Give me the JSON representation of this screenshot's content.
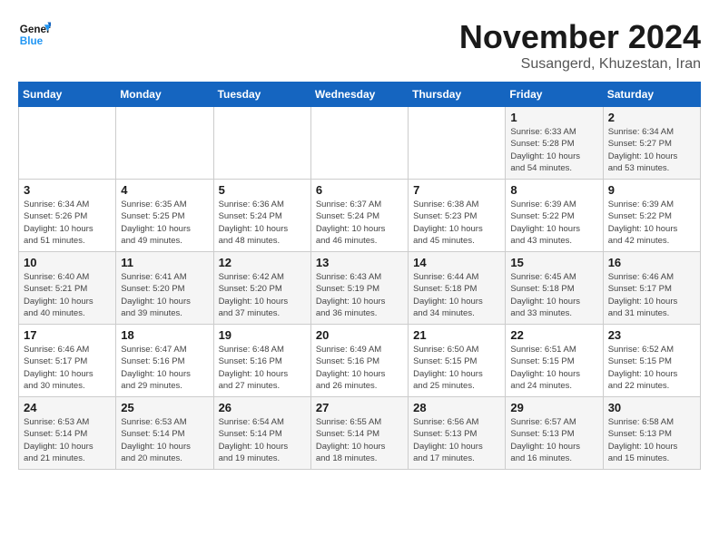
{
  "header": {
    "logo_line1": "General",
    "logo_line2": "Blue",
    "month": "November 2024",
    "location": "Susangerd, Khuzestan, Iran"
  },
  "days_of_week": [
    "Sunday",
    "Monday",
    "Tuesday",
    "Wednesday",
    "Thursday",
    "Friday",
    "Saturday"
  ],
  "weeks": [
    [
      {
        "day": "",
        "info": ""
      },
      {
        "day": "",
        "info": ""
      },
      {
        "day": "",
        "info": ""
      },
      {
        "day": "",
        "info": ""
      },
      {
        "day": "",
        "info": ""
      },
      {
        "day": "1",
        "info": "Sunrise: 6:33 AM\nSunset: 5:28 PM\nDaylight: 10 hours\nand 54 minutes."
      },
      {
        "day": "2",
        "info": "Sunrise: 6:34 AM\nSunset: 5:27 PM\nDaylight: 10 hours\nand 53 minutes."
      }
    ],
    [
      {
        "day": "3",
        "info": "Sunrise: 6:34 AM\nSunset: 5:26 PM\nDaylight: 10 hours\nand 51 minutes."
      },
      {
        "day": "4",
        "info": "Sunrise: 6:35 AM\nSunset: 5:25 PM\nDaylight: 10 hours\nand 49 minutes."
      },
      {
        "day": "5",
        "info": "Sunrise: 6:36 AM\nSunset: 5:24 PM\nDaylight: 10 hours\nand 48 minutes."
      },
      {
        "day": "6",
        "info": "Sunrise: 6:37 AM\nSunset: 5:24 PM\nDaylight: 10 hours\nand 46 minutes."
      },
      {
        "day": "7",
        "info": "Sunrise: 6:38 AM\nSunset: 5:23 PM\nDaylight: 10 hours\nand 45 minutes."
      },
      {
        "day": "8",
        "info": "Sunrise: 6:39 AM\nSunset: 5:22 PM\nDaylight: 10 hours\nand 43 minutes."
      },
      {
        "day": "9",
        "info": "Sunrise: 6:39 AM\nSunset: 5:22 PM\nDaylight: 10 hours\nand 42 minutes."
      }
    ],
    [
      {
        "day": "10",
        "info": "Sunrise: 6:40 AM\nSunset: 5:21 PM\nDaylight: 10 hours\nand 40 minutes."
      },
      {
        "day": "11",
        "info": "Sunrise: 6:41 AM\nSunset: 5:20 PM\nDaylight: 10 hours\nand 39 minutes."
      },
      {
        "day": "12",
        "info": "Sunrise: 6:42 AM\nSunset: 5:20 PM\nDaylight: 10 hours\nand 37 minutes."
      },
      {
        "day": "13",
        "info": "Sunrise: 6:43 AM\nSunset: 5:19 PM\nDaylight: 10 hours\nand 36 minutes."
      },
      {
        "day": "14",
        "info": "Sunrise: 6:44 AM\nSunset: 5:18 PM\nDaylight: 10 hours\nand 34 minutes."
      },
      {
        "day": "15",
        "info": "Sunrise: 6:45 AM\nSunset: 5:18 PM\nDaylight: 10 hours\nand 33 minutes."
      },
      {
        "day": "16",
        "info": "Sunrise: 6:46 AM\nSunset: 5:17 PM\nDaylight: 10 hours\nand 31 minutes."
      }
    ],
    [
      {
        "day": "17",
        "info": "Sunrise: 6:46 AM\nSunset: 5:17 PM\nDaylight: 10 hours\nand 30 minutes."
      },
      {
        "day": "18",
        "info": "Sunrise: 6:47 AM\nSunset: 5:16 PM\nDaylight: 10 hours\nand 29 minutes."
      },
      {
        "day": "19",
        "info": "Sunrise: 6:48 AM\nSunset: 5:16 PM\nDaylight: 10 hours\nand 27 minutes."
      },
      {
        "day": "20",
        "info": "Sunrise: 6:49 AM\nSunset: 5:16 PM\nDaylight: 10 hours\nand 26 minutes."
      },
      {
        "day": "21",
        "info": "Sunrise: 6:50 AM\nSunset: 5:15 PM\nDaylight: 10 hours\nand 25 minutes."
      },
      {
        "day": "22",
        "info": "Sunrise: 6:51 AM\nSunset: 5:15 PM\nDaylight: 10 hours\nand 24 minutes."
      },
      {
        "day": "23",
        "info": "Sunrise: 6:52 AM\nSunset: 5:15 PM\nDaylight: 10 hours\nand 22 minutes."
      }
    ],
    [
      {
        "day": "24",
        "info": "Sunrise: 6:53 AM\nSunset: 5:14 PM\nDaylight: 10 hours\nand 21 minutes."
      },
      {
        "day": "25",
        "info": "Sunrise: 6:53 AM\nSunset: 5:14 PM\nDaylight: 10 hours\nand 20 minutes."
      },
      {
        "day": "26",
        "info": "Sunrise: 6:54 AM\nSunset: 5:14 PM\nDaylight: 10 hours\nand 19 minutes."
      },
      {
        "day": "27",
        "info": "Sunrise: 6:55 AM\nSunset: 5:14 PM\nDaylight: 10 hours\nand 18 minutes."
      },
      {
        "day": "28",
        "info": "Sunrise: 6:56 AM\nSunset: 5:13 PM\nDaylight: 10 hours\nand 17 minutes."
      },
      {
        "day": "29",
        "info": "Sunrise: 6:57 AM\nSunset: 5:13 PM\nDaylight: 10 hours\nand 16 minutes."
      },
      {
        "day": "30",
        "info": "Sunrise: 6:58 AM\nSunset: 5:13 PM\nDaylight: 10 hours\nand 15 minutes."
      }
    ]
  ]
}
